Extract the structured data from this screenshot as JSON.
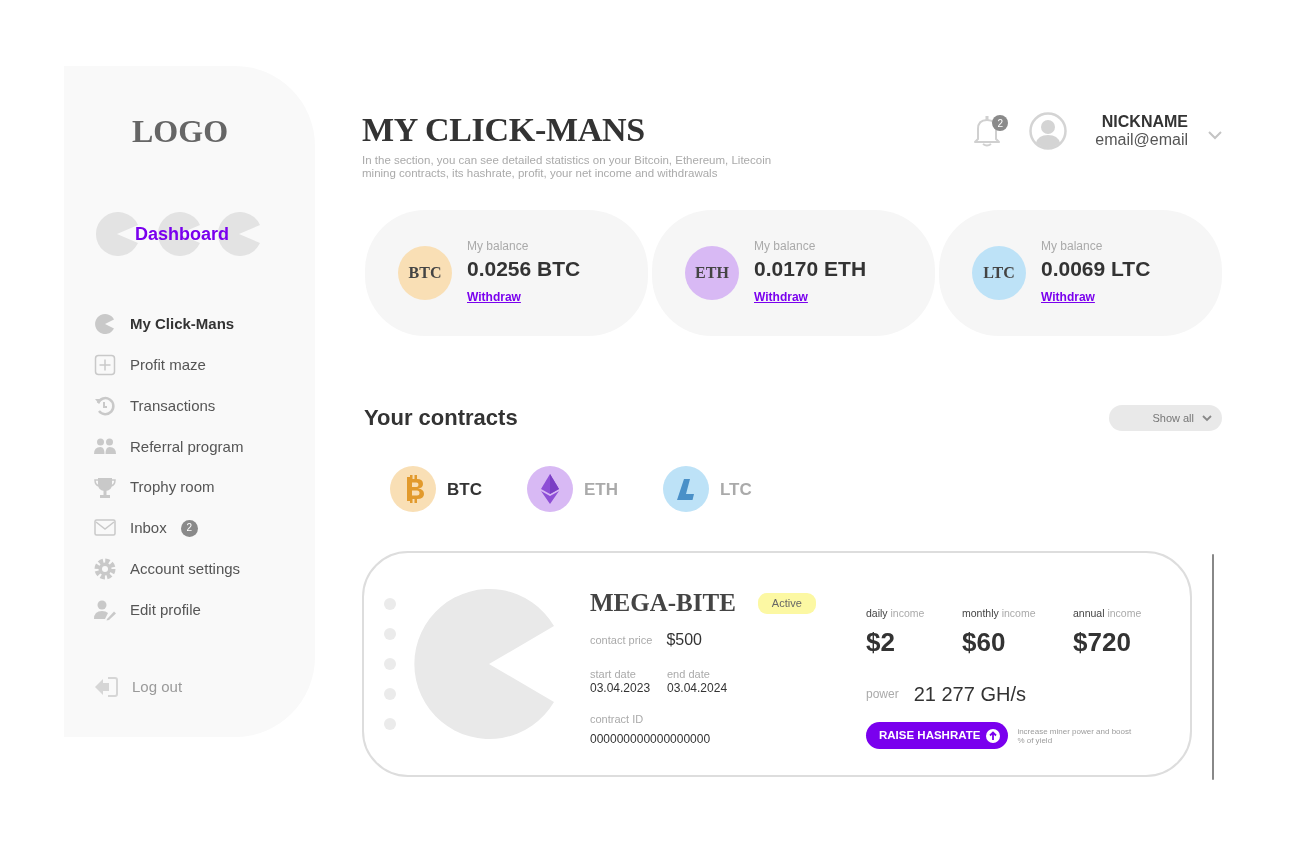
{
  "sidebar": {
    "logo": "LOGO",
    "dashboard": "Dashboard",
    "items": [
      {
        "label": "My Click-Mans",
        "selected": true
      },
      {
        "label": "Profit maze",
        "selected": false
      },
      {
        "label": "Transactions",
        "selected": false
      },
      {
        "label": "Referral program",
        "selected": false
      },
      {
        "label": "Trophy room",
        "selected": false
      },
      {
        "label": "Inbox",
        "selected": false,
        "badge": "2"
      },
      {
        "label": "Account settings",
        "selected": false
      },
      {
        "label": "Edit profile",
        "selected": false
      }
    ],
    "logout": "Log out"
  },
  "header": {
    "title": "MY CLICK-MANS",
    "description": "In the section, you can see detailed statistics on your Bitcoin, Ethereum, Litecoin mining contracts, its hashrate, profit, your net income and withdrawals",
    "notification_badge": "2",
    "user": {
      "nickname": "NICKNAME",
      "email": "email@email"
    }
  },
  "balances": [
    {
      "symbol": "BTC",
      "color": "#f9dfb5",
      "label": "My balance",
      "amount": "0.0256 BTC",
      "action": "Withdraw"
    },
    {
      "symbol": "ETH",
      "color": "#d8b9f4",
      "label": "My balance",
      "amount": "0.0170 ETH",
      "action": "Withdraw"
    },
    {
      "symbol": "LTC",
      "color": "#bde2f7",
      "label": "My balance",
      "amount": "0.0069 LTC",
      "action": "Withdraw"
    }
  ],
  "contracts": {
    "title": "Your contracts",
    "filter": "Show all",
    "coin_tabs": [
      {
        "label": "BTC",
        "color": "#f9dfb5",
        "selected": true
      },
      {
        "label": "ETH",
        "color": "#d8b9f4",
        "selected": false
      },
      {
        "label": "LTC",
        "color": "#bde2f7",
        "selected": false
      }
    ],
    "items": [
      {
        "name": "MEGA-BITE",
        "status": "Active",
        "price_label": "contact price",
        "price": "$500",
        "start_label": "start date",
        "start": "03.04.2023",
        "end_label": "end date",
        "end": "03.04.2024",
        "id_label": "contract ID",
        "id": "000000000000000000",
        "incomes": [
          {
            "label": "**daily** income",
            "value": "$2"
          },
          {
            "label": "**monthly** income",
            "value": "$60"
          },
          {
            "label": "**annual** income",
            "value": "$720"
          }
        ],
        "power_label": "power",
        "power": "21 277 GH/s",
        "action": "RAISE HASHRATE",
        "note": "increase miner power and boost % of yield"
      }
    ]
  }
}
